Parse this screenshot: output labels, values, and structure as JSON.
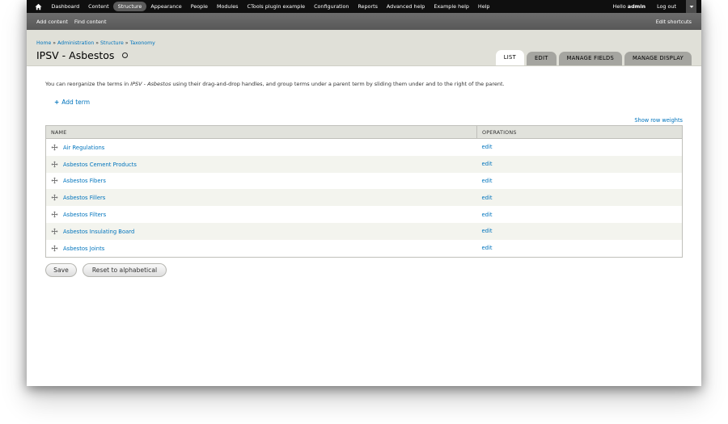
{
  "toolbar": {
    "items": [
      "Dashboard",
      "Content",
      "Structure",
      "Appearance",
      "People",
      "Modules",
      "CTools plugin example",
      "Configuration",
      "Reports",
      "Advanced help",
      "Example help",
      "Help"
    ],
    "active": "Structure",
    "hello_prefix": "Hello ",
    "username": "admin",
    "logout": "Log out"
  },
  "shortcuts": {
    "items": [
      "Add content",
      "Find content"
    ],
    "edit": "Edit shortcuts"
  },
  "breadcrumb": [
    "Home",
    "Administration",
    "Structure",
    "Taxonomy"
  ],
  "breadcrumb_separator": " » ",
  "page_title": "IPSV - Asbestos",
  "tabs": [
    {
      "label": "LIST",
      "active": true
    },
    {
      "label": "EDIT",
      "active": false
    },
    {
      "label": "MANAGE FIELDS",
      "active": false
    },
    {
      "label": "MANAGE DISPLAY",
      "active": false
    }
  ],
  "help": {
    "before": "You can reorganize the terms in ",
    "vocab": "IPSV - Asbestos",
    "after": " using their drag-and-drop handles, and group terms under a parent term by sliding them under and to the right of the parent."
  },
  "add_term": {
    "plus": "+",
    "label": "Add term"
  },
  "show_row_weights": "Show row weights",
  "table": {
    "headers": {
      "name": "NAME",
      "operations": "OPERATIONS"
    },
    "rows": [
      {
        "name": "Air Regulations",
        "op": "edit"
      },
      {
        "name": "Asbestos Cement Products",
        "op": "edit"
      },
      {
        "name": "Asbestos Fibers",
        "op": "edit"
      },
      {
        "name": "Asbestos Fillers",
        "op": "edit"
      },
      {
        "name": "Asbestos Filters",
        "op": "edit"
      },
      {
        "name": "Asbestos Insulating Board",
        "op": "edit"
      },
      {
        "name": "Asbestos Joints",
        "op": "edit"
      }
    ]
  },
  "buttons": {
    "save": "Save",
    "reset": "Reset to alphabetical"
  },
  "colors": {
    "link": "#0074bd",
    "toolbar": "#0f0f0f",
    "shortcuts": "#5e5e5e",
    "branding": "#e0e0d8"
  },
  "icons": {
    "home": "home-icon",
    "drawer": "chevron-down-icon",
    "drag": "drag-handle-icon",
    "star": "shortcut-star-icon"
  }
}
